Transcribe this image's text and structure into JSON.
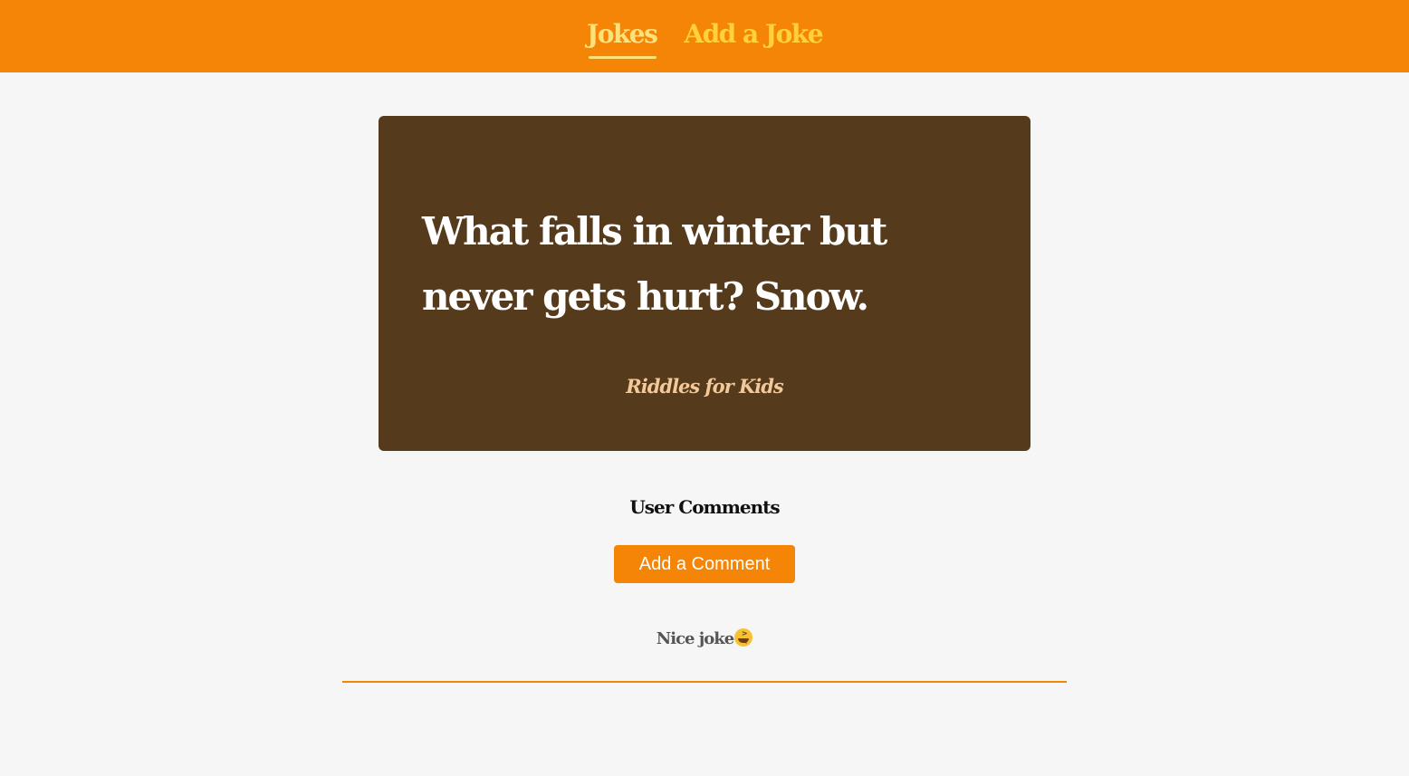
{
  "nav": {
    "items": [
      {
        "label": "Jokes",
        "active": true
      },
      {
        "label": "Add a Joke",
        "active": false
      }
    ]
  },
  "joke": {
    "text": "What falls in winter but never gets hurt? Snow.",
    "category": "Riddles for Kids"
  },
  "comments": {
    "title": "User Comments",
    "add_button_label": "Add a Comment",
    "items": [
      {
        "text": "Nice joke",
        "emoji": "laughing-face-icon"
      }
    ]
  },
  "colors": {
    "header": "#f48506",
    "nav_link": "#ffd23a",
    "card": "#553a1b",
    "card_text": "#ffffff",
    "category": "#f3c99a",
    "background": "#f6f6f6"
  }
}
